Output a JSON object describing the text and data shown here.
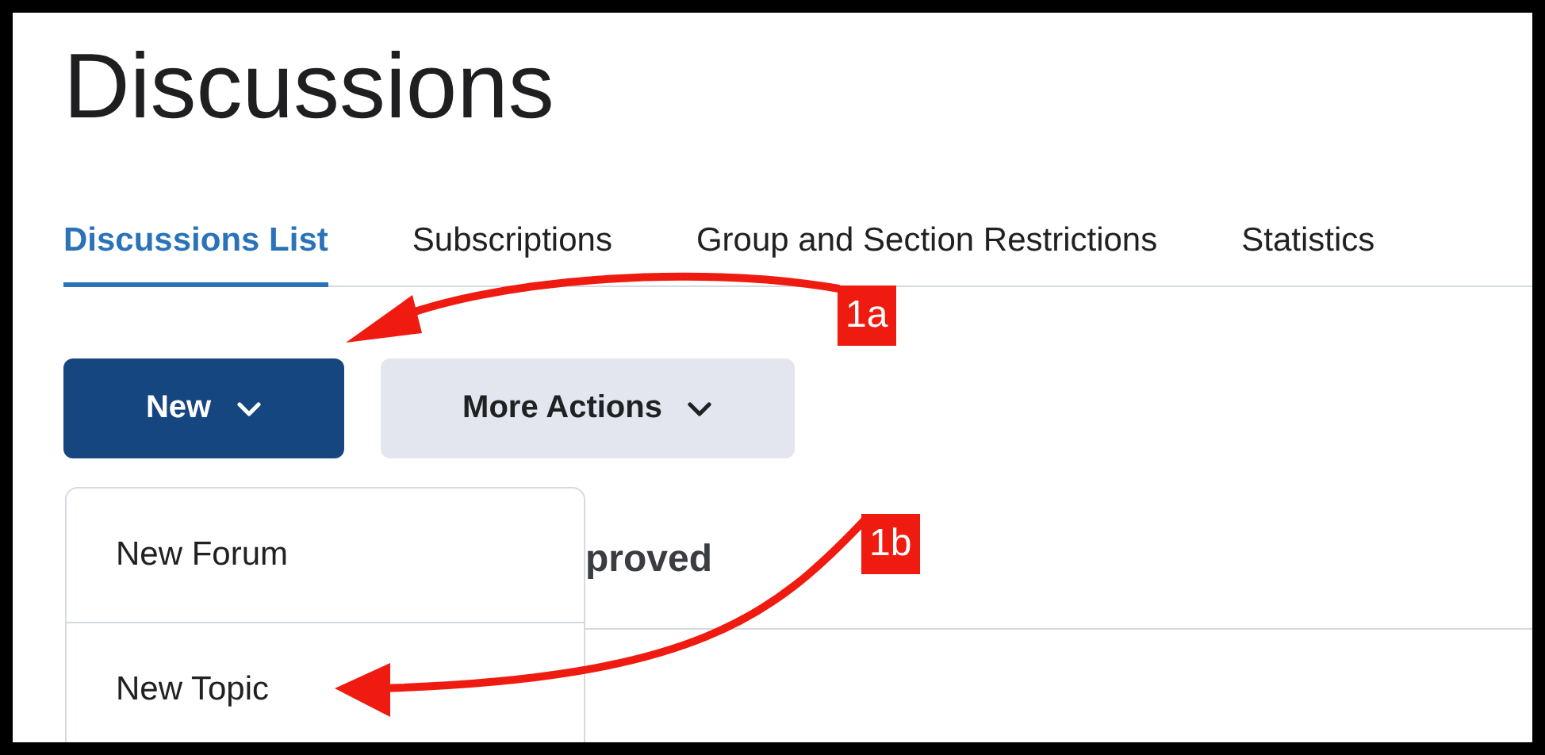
{
  "page": {
    "title": "Discussions"
  },
  "tabs": [
    {
      "label": "Discussions List",
      "selected": true
    },
    {
      "label": "Subscriptions",
      "selected": false
    },
    {
      "label": "Group and Section Restrictions",
      "selected": false
    },
    {
      "label": "Statistics",
      "selected": false
    }
  ],
  "buttons": [
    {
      "label": "New",
      "kind": "primary"
    },
    {
      "label": "More Actions",
      "kind": "secondary"
    }
  ],
  "new_menu": {
    "items": [
      {
        "label": "New Forum"
      },
      {
        "label": "New Topic"
      }
    ]
  },
  "behind_menu": {
    "heading": "proved"
  },
  "annotations": [
    {
      "label": "1a"
    },
    {
      "label": "1b"
    }
  ]
}
